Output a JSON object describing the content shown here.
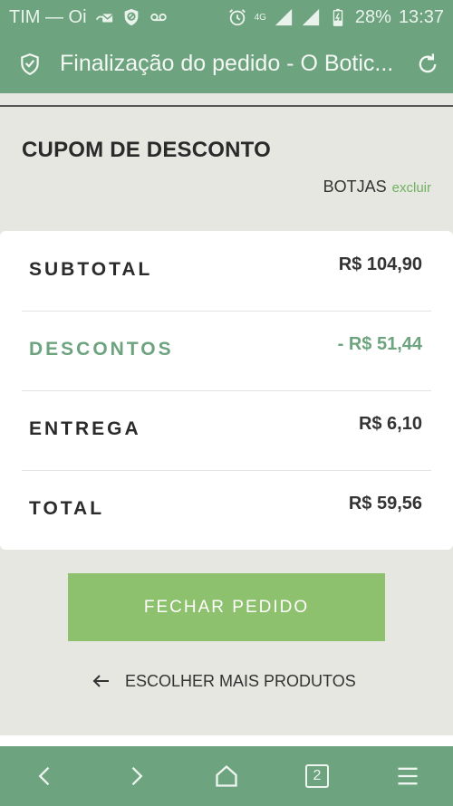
{
  "status_bar": {
    "carrier": "TIM — Oi",
    "network": "4G",
    "battery": "28%",
    "time": "13:37"
  },
  "browser": {
    "title": "Finalização do pedido - O Botic..."
  },
  "coupon": {
    "title": "CUPOM DE DESCONTO",
    "code": "BOTJAS",
    "remove_label": "excluir"
  },
  "summary": {
    "rows": [
      {
        "label": "SUBTOTAL",
        "value": "R$ 104,90"
      },
      {
        "label": "DESCONTOS",
        "value": "- R$ 51,44"
      },
      {
        "label": "ENTREGA",
        "value": "R$ 6,10"
      },
      {
        "label": "TOTAL",
        "value": "R$ 59,56"
      }
    ]
  },
  "actions": {
    "checkout_label": "FECHAR PEDIDO",
    "continue_label": "ESCOLHER MAIS PRODUTOS"
  },
  "bottom_nav": {
    "tab_count": "2"
  },
  "colors": {
    "brand_green": "#6da37e",
    "button_green": "#8dc16e",
    "link_green": "#72b062"
  }
}
